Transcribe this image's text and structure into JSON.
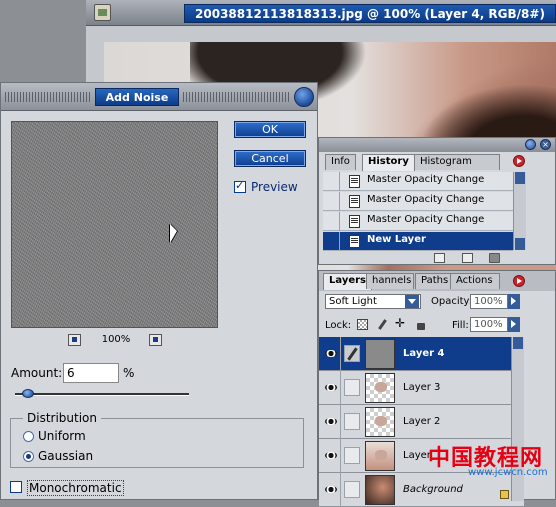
{
  "document": {
    "title": "20038812113818313.jpg @ 100% (Layer 4, RGB/8#)"
  },
  "dialog": {
    "title": "Add Noise",
    "ok_label": "OK",
    "cancel_label": "Cancel",
    "preview_label": "Preview",
    "preview_checked": true,
    "zoom": "100%",
    "amount_label": "Amount:",
    "amount_value": "6",
    "amount_unit": "%",
    "amount_slider_fraction": 0.06,
    "distribution_label": "Distribution",
    "distribution_options": [
      "Uniform",
      "Gaussian"
    ],
    "distribution_selected": "Gaussian",
    "monochromatic_label": "Monochromatic",
    "monochromatic_checked": false
  },
  "history_panel": {
    "tabs": [
      "Info",
      "History",
      "Histogram"
    ],
    "active_tab": "History",
    "items": [
      {
        "label": "Master Opacity Change"
      },
      {
        "label": "Master Opacity Change"
      },
      {
        "label": "Master Opacity Change"
      },
      {
        "label": "New Layer",
        "selected": true
      }
    ]
  },
  "layers_panel": {
    "tabs": [
      "Layers",
      "Channels",
      "Paths",
      "Actions"
    ],
    "tab_display": [
      "Layers",
      "hannels",
      "Paths",
      "Actions"
    ],
    "active_tab": "Layers",
    "blend_mode": "Soft Light",
    "opacity_label": "Opacity:",
    "opacity_value": "100%",
    "lock_label": "Lock:",
    "fill_label": "Fill:",
    "fill_value": "100%",
    "layers": [
      {
        "name": "Layer 4",
        "selected": true
      },
      {
        "name": "Layer 3"
      },
      {
        "name": "Layer 2"
      },
      {
        "name": "Layer"
      },
      {
        "name": "Background"
      }
    ]
  },
  "watermark": {
    "text": "中国教程网",
    "url": "www.jcwcn.com"
  },
  "colors": {
    "title_blue": "#0c3a86",
    "selection_blue": "#0f3d8b",
    "panel_gray": "#d4d7dc",
    "watermark_red": "#e60012"
  }
}
